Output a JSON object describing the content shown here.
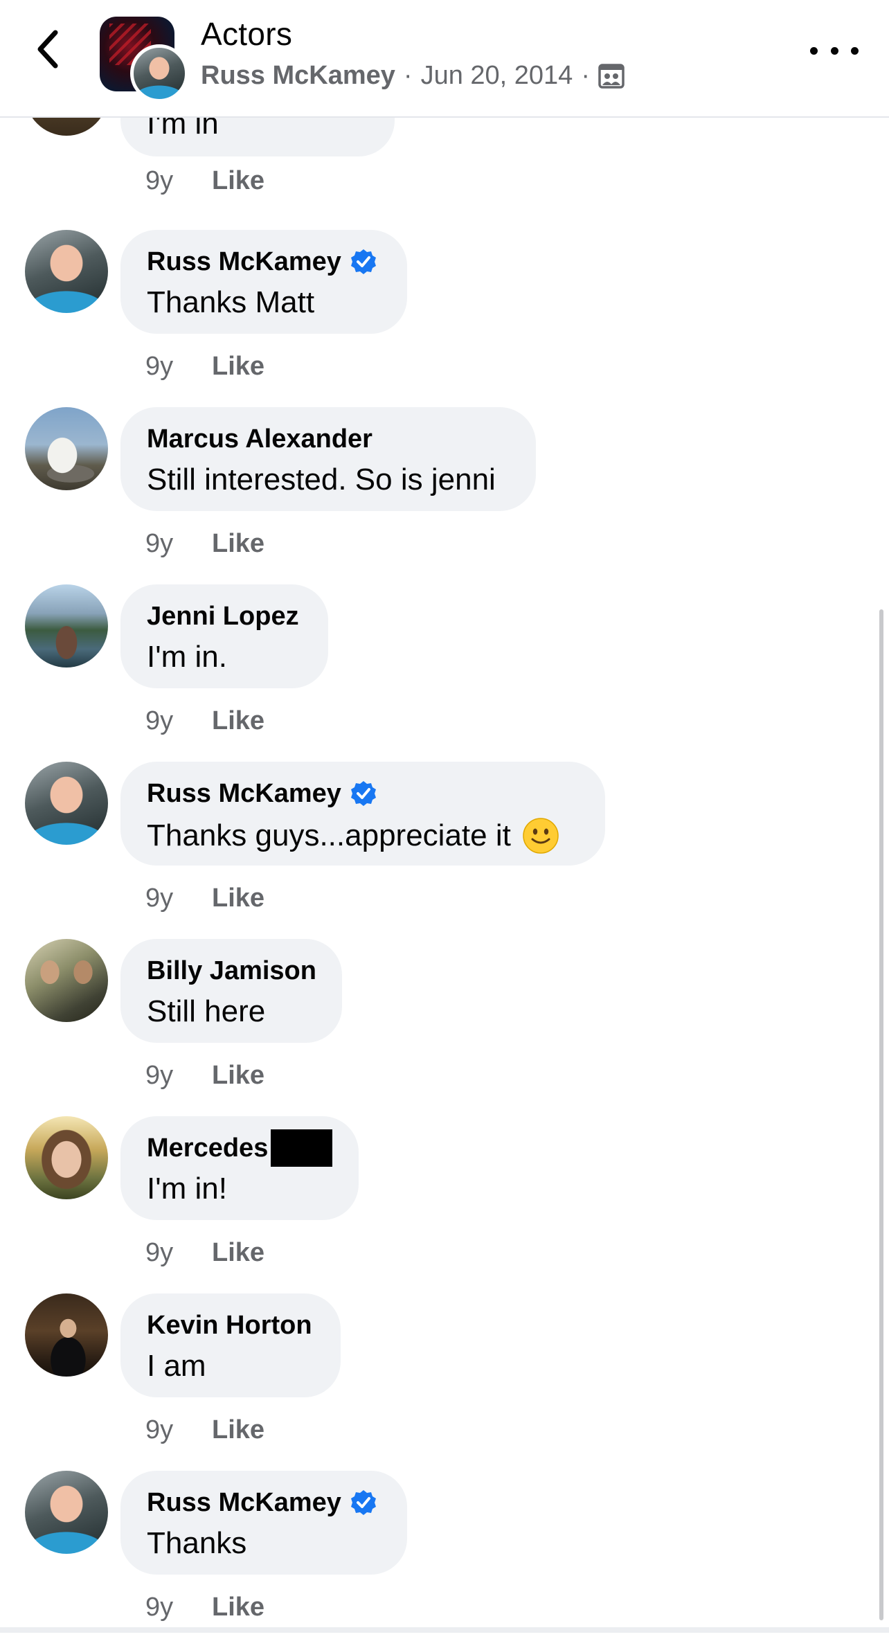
{
  "header": {
    "title": "Actors",
    "author": "Russ McKamey",
    "date": "Jun 20, 2014",
    "separator": "·",
    "audience_icon": "group-audience-icon",
    "back_icon": "chevron-left-icon",
    "more_icon": "more-horizontal-icon"
  },
  "partial_comment": {
    "text": "I'm in",
    "age": "9y",
    "like_label": "Like"
  },
  "comments": [
    {
      "name": "Russ McKamey",
      "verified": true,
      "text": "Thanks Matt",
      "age": "9y",
      "like_label": "Like"
    },
    {
      "name": "Marcus Alexander",
      "verified": false,
      "text": "Still interested. So is jenni",
      "age": "9y",
      "like_label": "Like"
    },
    {
      "name": "Jenni Lopez",
      "verified": false,
      "text": "I'm in.",
      "age": "9y",
      "like_label": "Like"
    },
    {
      "name": "Russ McKamey",
      "verified": true,
      "text": "Thanks guys...appreciate it",
      "emoji": "slightly-smiling-face",
      "age": "9y",
      "like_label": "Like"
    },
    {
      "name": "Billy Jamison",
      "verified": false,
      "text": "Still here",
      "age": "9y",
      "like_label": "Like"
    },
    {
      "name": "Mercedes",
      "verified": false,
      "redacted_surname": true,
      "text": "I'm in!",
      "age": "9y",
      "like_label": "Like"
    },
    {
      "name": "Kevin Horton",
      "verified": false,
      "text": "I am",
      "age": "9y",
      "like_label": "Like"
    },
    {
      "name": "Russ McKamey",
      "verified": true,
      "text": "Thanks",
      "age": "9y",
      "like_label": "Like"
    }
  ],
  "colors": {
    "bubble": "#f0f2f5",
    "secondary_text": "#65676b",
    "verified_blue": "#1877f2"
  }
}
